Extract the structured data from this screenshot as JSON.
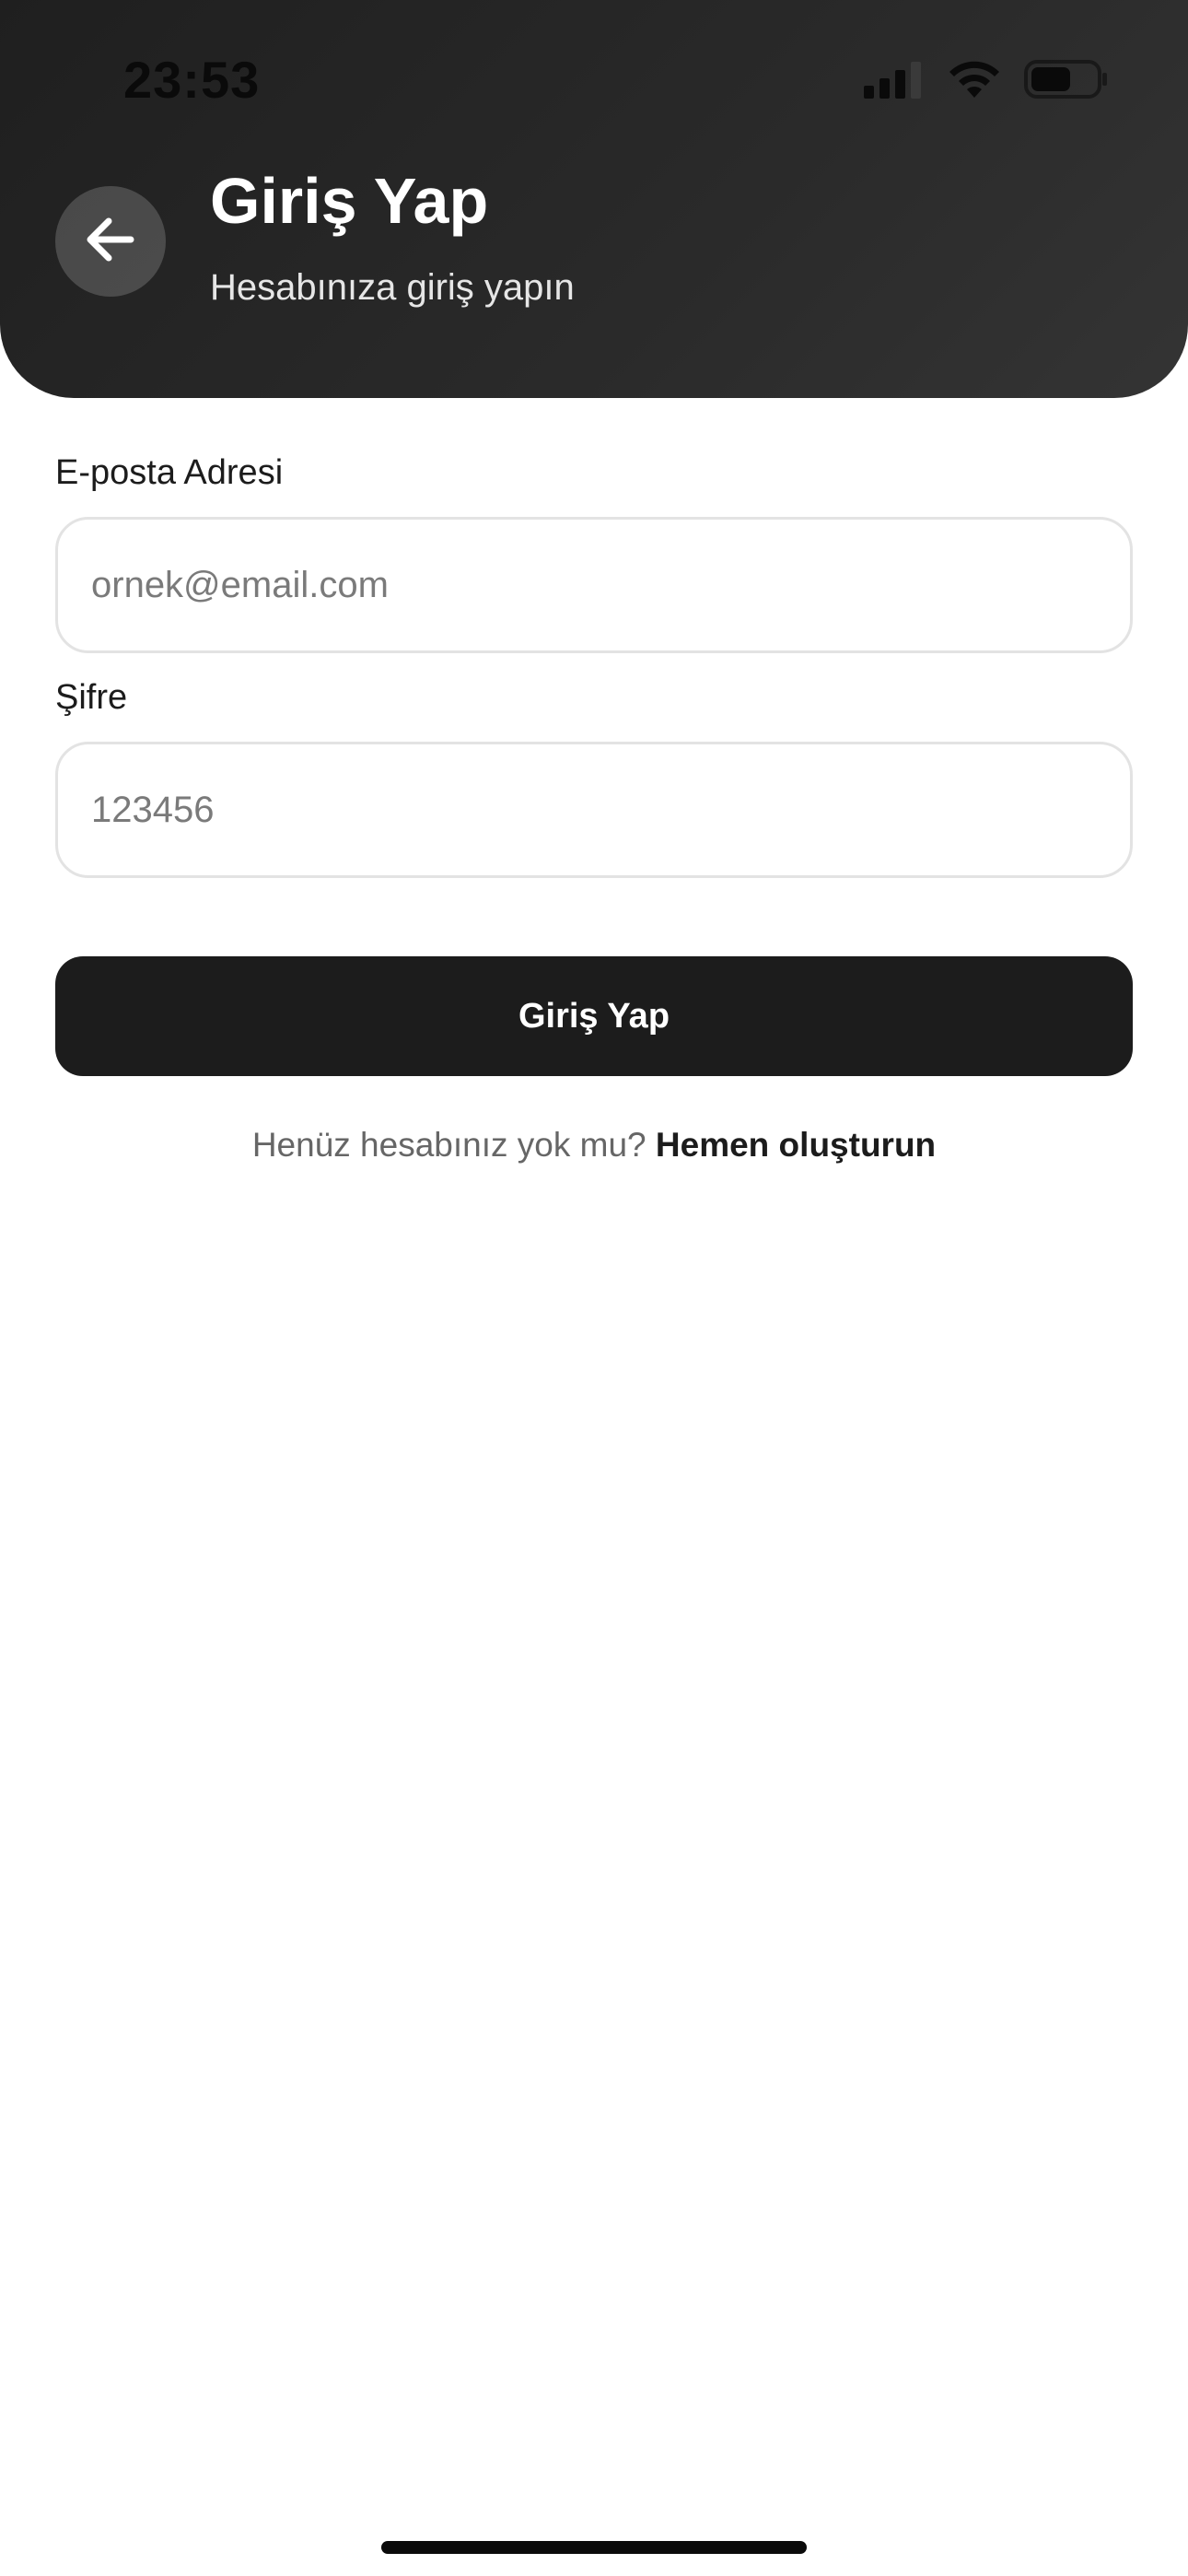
{
  "status_bar": {
    "time": "23:53",
    "icons": [
      "cellular-signal-icon",
      "wifi-icon",
      "battery-icon"
    ]
  },
  "header": {
    "back_icon": "arrow-left-icon",
    "title": "Giriş Yap",
    "subtitle": "Hesabınıza giriş yapın"
  },
  "form": {
    "email": {
      "label": "E-posta Adresi",
      "placeholder": "ornek@email.com",
      "value": ""
    },
    "password": {
      "label": "Şifre",
      "placeholder": "123456",
      "value": ""
    },
    "submit_label": "Giriş Yap"
  },
  "signup": {
    "prompt": "Henüz hesabınız yok mu?",
    "link": "Hemen oluşturun"
  },
  "colors": {
    "header_bg": "#242424",
    "primary_button": "#1c1c1c",
    "input_border": "#e3e3e3",
    "muted_text": "#666666"
  }
}
